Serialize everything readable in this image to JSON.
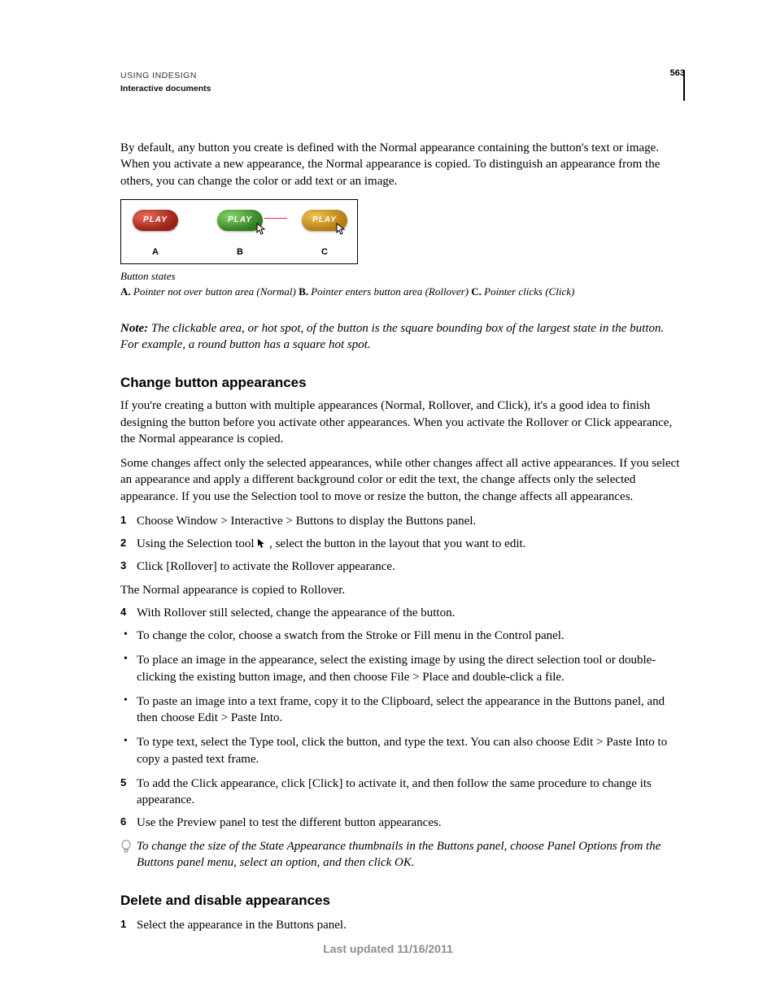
{
  "header": {
    "line1": "USING INDESIGN",
    "line2": "Interactive documents",
    "page_number": "563"
  },
  "intro_paragraph": "By default, any button you create is defined with the Normal appearance containing the button's text or image. When you activate a new appearance, the Normal appearance is copied. To distinguish an appearance from the others, you can change the color or add text or an image.",
  "figure": {
    "pill_label": "PLAY",
    "letters": {
      "a": "A",
      "b": "B",
      "c": "C"
    },
    "caption_title": "Button states",
    "legend_a_key": "A.",
    "legend_a_text": " Pointer not over button area (Normal)  ",
    "legend_b_key": "B.",
    "legend_b_text": " Pointer enters button area (Rollover)  ",
    "legend_c_key": "C.",
    "legend_c_text": " Pointer clicks (Click)"
  },
  "note": {
    "label": "Note: ",
    "text": "The clickable area, or hot spot, of the button is the square bounding box of the largest state in the button. For example, a round button has a square hot spot."
  },
  "section_change": {
    "heading": "Change button appearances",
    "para1": "If you're creating a button with multiple appearances (Normal, Rollover, and Click), it's a good idea to finish designing the button before you activate other appearances. When you activate the Rollover or Click appearance, the Normal appearance is copied.",
    "para2": "Some changes affect only the selected appearances, while other changes affect all active appearances. If you select an appearance and apply a different background color or edit the text, the change affects only the selected appearance. If you use the Selection tool to move or resize the button, the change affects all appearances.",
    "step1": "Choose Window > Interactive > Buttons to display the Buttons panel.",
    "step2_pre": "Using the Selection tool ",
    "step2_post": " , select the button in the layout that you want to edit.",
    "step3": "Click [Rollover] to activate the Rollover appearance.",
    "after3": "The Normal appearance is copied to Rollover.",
    "step4": "With Rollover still selected, change the appearance of the button.",
    "bullet1": "To change the color, choose a swatch from the Stroke or Fill menu in the Control panel.",
    "bullet2": "To place an image in the appearance, select the existing image by using the direct selection tool or double-clicking the existing button image, and then choose File > Place and double-click a file.",
    "bullet3": "To paste an image into a text frame, copy it to the Clipboard, select the appearance in the Buttons panel, and then choose Edit > Paste Into.",
    "bullet4": "To type text, select the Type tool, click the button, and type the text. You can also choose Edit > Paste Into to copy a pasted text frame.",
    "step5": "To add the Click appearance, click [Click] to activate it, and then follow the same procedure to change its appearance.",
    "step6": "Use the Preview panel to test the different button appearances.",
    "tip": "To change the size of the State Appearance thumbnails in the Buttons panel, choose Panel Options from the Buttons panel menu, select an option, and then click OK."
  },
  "section_delete": {
    "heading": "Delete and disable appearances",
    "step1": "Select the appearance in the Buttons panel."
  },
  "footer": "Last updated 11/16/2011"
}
